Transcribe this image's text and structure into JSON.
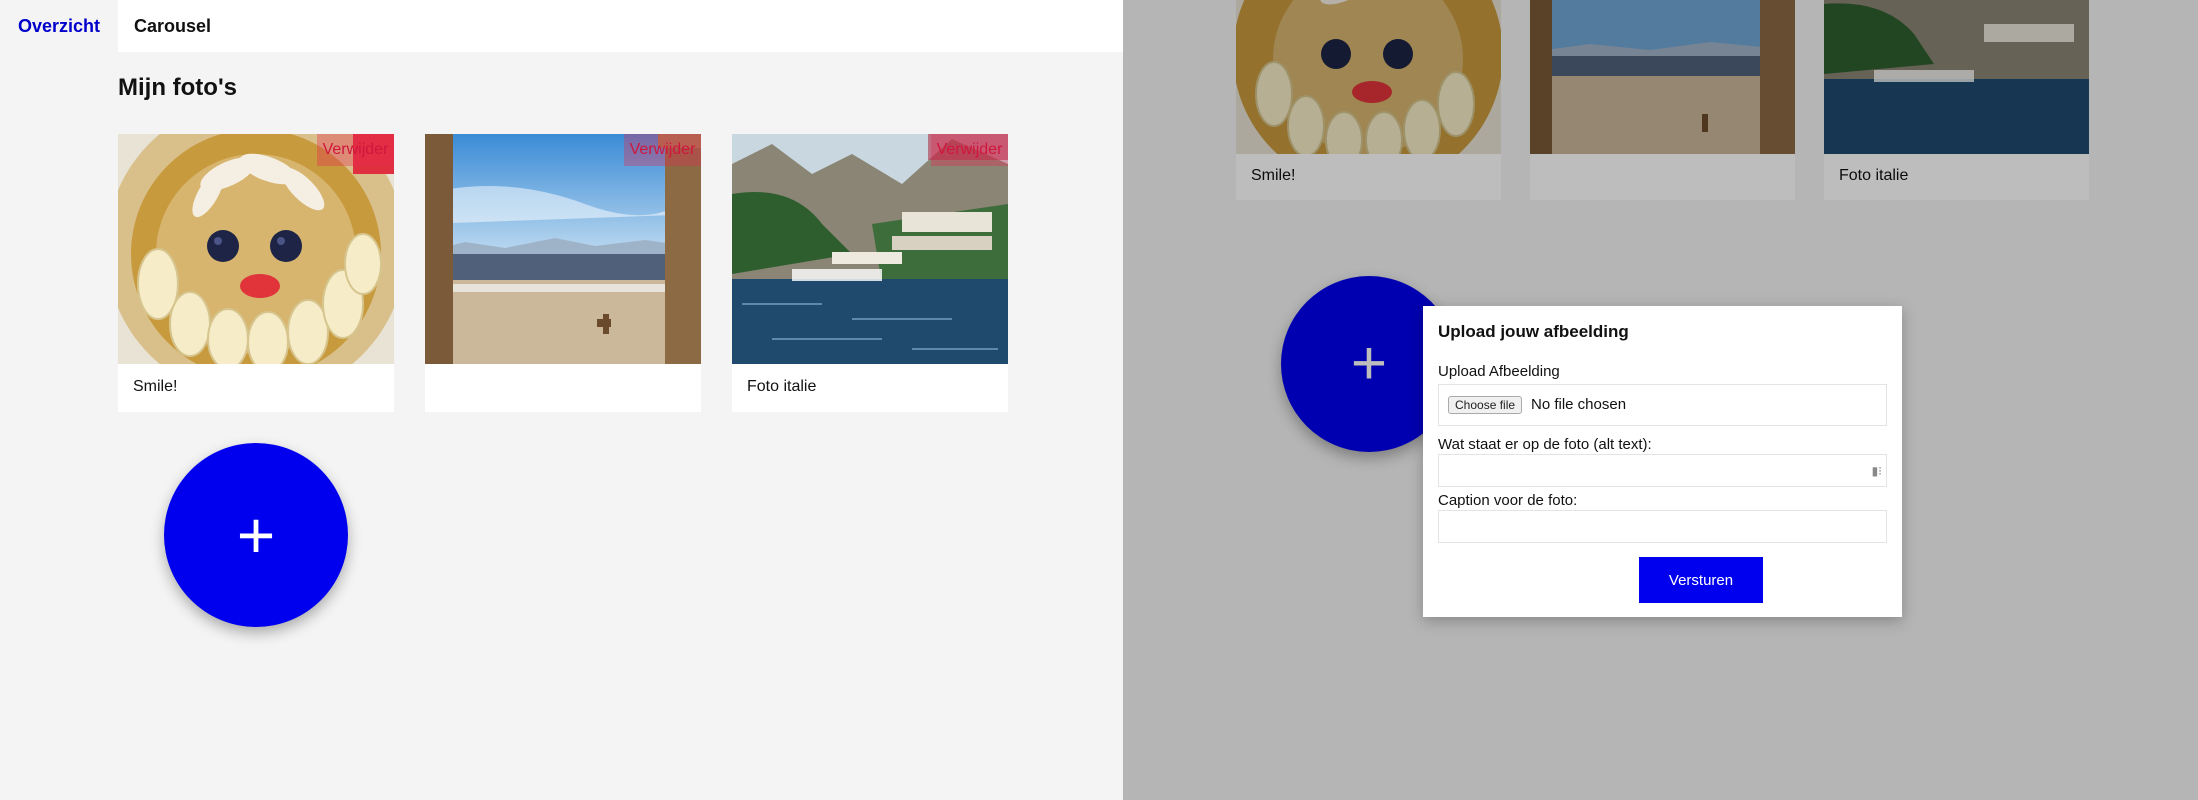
{
  "nav": {
    "tabs": [
      {
        "label": "Overzicht"
      },
      {
        "label": "Carousel"
      }
    ]
  },
  "gallery": {
    "heading": "Mijn foto's",
    "delete_label": "Verwijder",
    "cards": [
      {
        "caption": "Smile!",
        "image": "acai-bowl-smiley-face"
      },
      {
        "caption": "",
        "image": "coastal-view-between-pillars-with-dog"
      },
      {
        "caption": "Foto italie",
        "image": "italian-coastal-village-harbor"
      }
    ]
  },
  "fab": {
    "icon": "plus-icon",
    "symbol": "+"
  },
  "upload_modal": {
    "title": "Upload jouw afbeelding",
    "file_label": "Upload Afbeelding",
    "file_button": "Choose file",
    "file_status": "No file chosen",
    "alt_label": "Wat staat er op de foto (alt text):",
    "alt_value": "",
    "caption_label": "Caption voor de foto:",
    "caption_value": "",
    "submit_label": "Versturen"
  },
  "colors": {
    "accent": "#0000ee",
    "nav_active_text": "#0000cc",
    "delete_tint": "#e62850"
  }
}
